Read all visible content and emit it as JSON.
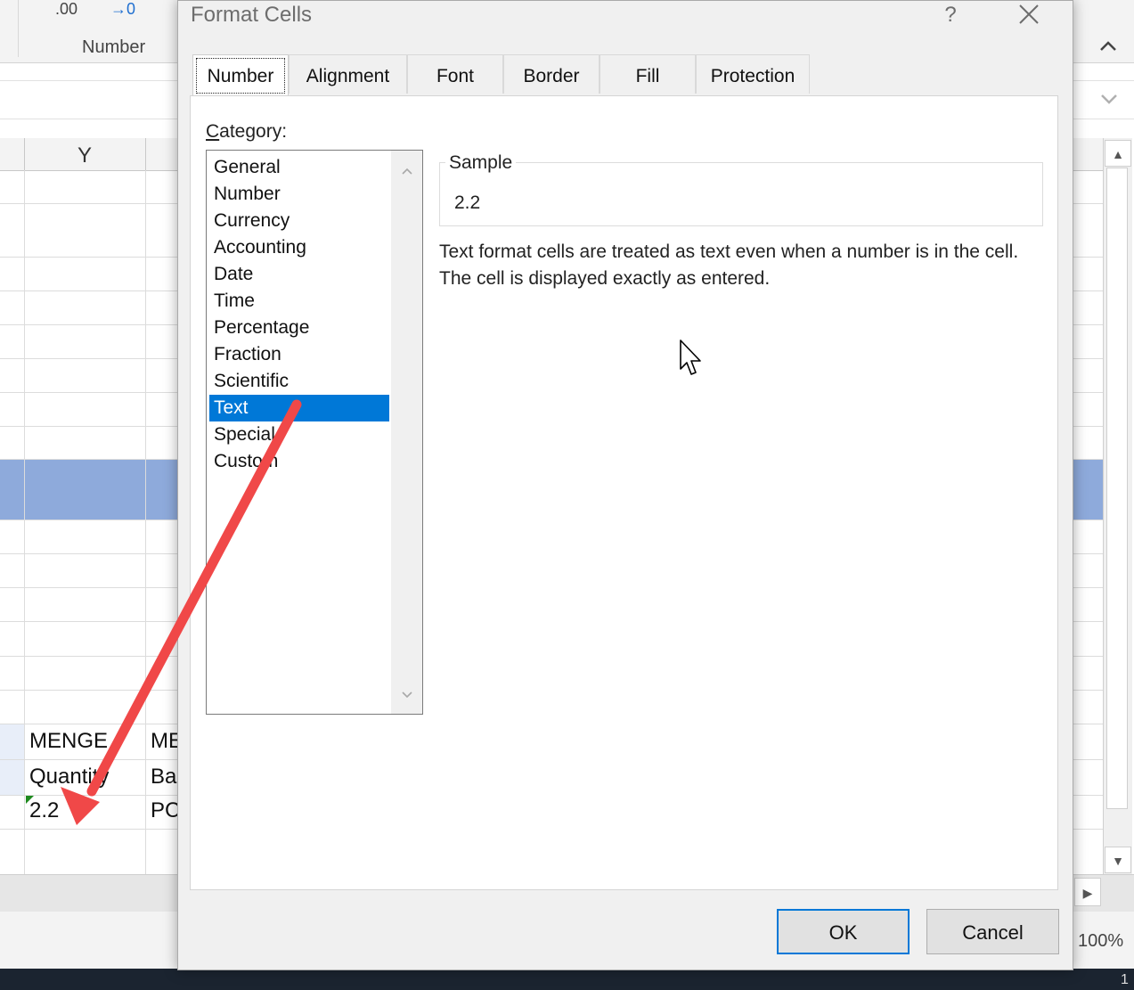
{
  "excel": {
    "ribbon": {
      "decrease_decimal": ".00",
      "increase_decimal": "→0",
      "group_label": "Number"
    },
    "column_header": "Y",
    "cells": {
      "menge": "MENGE",
      "me_partial": "ME",
      "quantity": "Quantity",
      "base_partial": "Ba",
      "value": "2.2",
      "pc_partial": "PC"
    },
    "zoom": "100%",
    "clock_partial": "1"
  },
  "dialog": {
    "title": "Format Cells",
    "help": "?",
    "tabs": [
      {
        "label": "Number",
        "active": true
      },
      {
        "label": "Alignment",
        "active": false
      },
      {
        "label": "Font",
        "active": false
      },
      {
        "label": "Border",
        "active": false
      },
      {
        "label": "Fill",
        "active": false
      },
      {
        "label": "Protection",
        "active": false
      }
    ],
    "category_label_key": "C",
    "category_label_rest": "ategory:",
    "categories": [
      "General",
      "Number",
      "Currency",
      "Accounting",
      "Date",
      "Time",
      "Percentage",
      "Fraction",
      "Scientific",
      "Text",
      "Special",
      "Custom"
    ],
    "selected_category": "Text",
    "sample": {
      "legend": "Sample",
      "value": "2.2"
    },
    "description": [
      "Text format cells are treated as text even when a number is in the cell.",
      "The cell is displayed exactly as entered."
    ],
    "buttons": {
      "ok": "OK",
      "cancel": "Cancel"
    }
  },
  "annotation": {
    "arrow_color": "#f04848"
  },
  "colors": {
    "selection": "#0078d7",
    "band": "#8eaadb"
  }
}
